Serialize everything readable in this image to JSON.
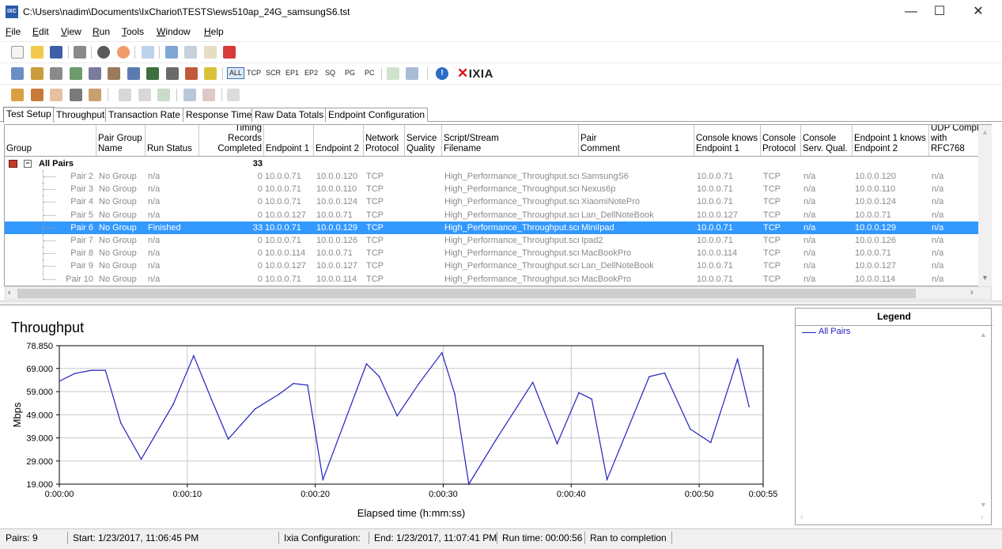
{
  "window": {
    "title": "C:\\Users\\nadim\\Documents\\IxChariot\\TESTS\\ews510ap_24G_samsungS6.tst",
    "app_icon_text": "IXC",
    "minimize": "—",
    "maximize": "☐",
    "close": "✕"
  },
  "menu": {
    "items": [
      {
        "label": "File",
        "key": "F",
        "rest": "ile"
      },
      {
        "label": "Edit",
        "key": "E",
        "rest": "dit"
      },
      {
        "label": "View",
        "key": "V",
        "rest": "iew"
      },
      {
        "label": "Run",
        "key": "R",
        "rest": "un"
      },
      {
        "label": "Tools",
        "key": "T",
        "rest": "ools"
      },
      {
        "label": "Window",
        "key": "W",
        "rest": "indow"
      },
      {
        "label": "Help",
        "key": "H",
        "rest": "elp"
      }
    ]
  },
  "toolbar2": {
    "filters": [
      "ALL",
      "TCP",
      "SCR",
      "EP1",
      "EP2",
      "SQ",
      "PG",
      "PC"
    ],
    "logo": "IXIA"
  },
  "tabs": [
    {
      "label": "Test Setup",
      "active": true
    },
    {
      "label": "Throughput",
      "active": false
    },
    {
      "label": "Transaction Rate",
      "active": false
    },
    {
      "label": "Response Time",
      "active": false
    },
    {
      "label": "Raw Data Totals",
      "active": false
    },
    {
      "label": "Endpoint Configuration",
      "active": false
    }
  ],
  "grid": {
    "columns": [
      "Group",
      "Pair Group\nName",
      "Run Status",
      "Timing Records\nCompleted",
      "Endpoint 1",
      "Endpoint 2",
      "Network\nProtocol",
      "Service\nQuality",
      "Script/Stream\nFilename",
      "Pair\nComment",
      "Console knows\nEndpoint 1",
      "Console\nProtocol",
      "Console\nServ. Qual.",
      "Endpoint 1 knows\nEndpoint 2",
      "UDP Compli\nwith RFC768"
    ],
    "all_pairs": {
      "label": "All Pairs",
      "records": "33"
    },
    "rows": [
      {
        "pair": "Pair 2",
        "group_name": "No Group",
        "status": "n/a",
        "records": "0",
        "ep1": "10.0.0.71",
        "ep2": "10.0.0.120",
        "proto": "TCP",
        "sq": "",
        "script": "High_Performance_Throughput.scr",
        "comment": "SamsungS6",
        "ck_ep1": "10.0.0.71",
        "c_proto": "TCP",
        "c_sq": "n/a",
        "ep1_knows": "10.0.0.120",
        "udp": "n/a",
        "selected": false
      },
      {
        "pair": "Pair 3",
        "group_name": "No Group",
        "status": "n/a",
        "records": "0",
        "ep1": "10.0.0.71",
        "ep2": "10.0.0.110",
        "proto": "TCP",
        "sq": "",
        "script": "High_Performance_Throughput.scr",
        "comment": "Nexus6p",
        "ck_ep1": "10.0.0.71",
        "c_proto": "TCP",
        "c_sq": "n/a",
        "ep1_knows": "10.0.0.110",
        "udp": "n/a",
        "selected": false
      },
      {
        "pair": "Pair 4",
        "group_name": "No Group",
        "status": "n/a",
        "records": "0",
        "ep1": "10.0.0.71",
        "ep2": "10.0.0.124",
        "proto": "TCP",
        "sq": "",
        "script": "High_Performance_Throughput.scr",
        "comment": "XiaomiNotePro",
        "ck_ep1": "10.0.0.71",
        "c_proto": "TCP",
        "c_sq": "n/a",
        "ep1_knows": "10.0.0.124",
        "udp": "n/a",
        "selected": false
      },
      {
        "pair": "Pair 5",
        "group_name": "No Group",
        "status": "n/a",
        "records": "0",
        "ep1": "10.0.0.127",
        "ep2": "10.0.0.71",
        "proto": "TCP",
        "sq": "",
        "script": "High_Performance_Throughput.scr",
        "comment": "Lan_DellNoteBook",
        "ck_ep1": "10.0.0.127",
        "c_proto": "TCP",
        "c_sq": "n/a",
        "ep1_knows": "10.0.0.71",
        "udp": "n/a",
        "selected": false
      },
      {
        "pair": "Pair 6",
        "group_name": "No Group",
        "status": "Finished",
        "records": "33",
        "ep1": "10.0.0.71",
        "ep2": "10.0.0.129",
        "proto": "TCP",
        "sq": "",
        "script": "High_Performance_Throughput.scr",
        "comment": "MiniIpad",
        "ck_ep1": "10.0.0.71",
        "c_proto": "TCP",
        "c_sq": "n/a",
        "ep1_knows": "10.0.0.129",
        "udp": "n/a",
        "selected": true
      },
      {
        "pair": "Pair 7",
        "group_name": "No Group",
        "status": "n/a",
        "records": "0",
        "ep1": "10.0.0.71",
        "ep2": "10.0.0.126",
        "proto": "TCP",
        "sq": "",
        "script": "High_Performance_Throughput.scr",
        "comment": "Ipad2",
        "ck_ep1": "10.0.0.71",
        "c_proto": "TCP",
        "c_sq": "n/a",
        "ep1_knows": "10.0.0.126",
        "udp": "n/a",
        "selected": false
      },
      {
        "pair": "Pair 8",
        "group_name": "No Group",
        "status": "n/a",
        "records": "0",
        "ep1": "10.0.0.114",
        "ep2": "10.0.0.71",
        "proto": "TCP",
        "sq": "",
        "script": "High_Performance_Throughput.scr",
        "comment": "MacBookPro",
        "ck_ep1": "10.0.0.114",
        "c_proto": "TCP",
        "c_sq": "n/a",
        "ep1_knows": "10.0.0.71",
        "udp": "n/a",
        "selected": false
      },
      {
        "pair": "Pair 9",
        "group_name": "No Group",
        "status": "n/a",
        "records": "0",
        "ep1": "10.0.0.127",
        "ep2": "10.0.0.127",
        "proto": "TCP",
        "sq": "",
        "script": "High_Performance_Throughput.scr",
        "comment": "Lan_DellNoteBook",
        "ck_ep1": "10.0.0.71",
        "c_proto": "TCP",
        "c_sq": "n/a",
        "ep1_knows": "10.0.0.127",
        "udp": "n/a",
        "selected": false
      },
      {
        "pair": "Pair 10",
        "group_name": "No Group",
        "status": "n/a",
        "records": "0",
        "ep1": "10.0.0.71",
        "ep2": "10.0.0.114",
        "proto": "TCP",
        "sq": "",
        "script": "High_Performance_Throughput.scr",
        "comment": "MacBookPro",
        "ck_ep1": "10.0.0.71",
        "c_proto": "TCP",
        "c_sq": "n/a",
        "ep1_knows": "10.0.0.114",
        "udp": "n/a",
        "selected": false
      }
    ]
  },
  "legend": {
    "title": "Legend",
    "entries": [
      {
        "name": "All Pairs",
        "color": "#2020c0"
      }
    ]
  },
  "chart_data": {
    "type": "line",
    "title": "Throughput",
    "xlabel": "Elapsed time (h:mm:ss)",
    "ylabel": "Mbps",
    "yticks": [
      "78.850",
      "69.000",
      "59.000",
      "49.000",
      "39.000",
      "29.000",
      "19.000"
    ],
    "ytick_values": [
      78.85,
      69,
      59,
      49,
      39,
      29,
      19
    ],
    "xticks": [
      "0:00:00",
      "0:00:10",
      "0:00:20",
      "0:00:30",
      "0:00:40",
      "0:00:50",
      "0:00:55"
    ],
    "xtick_values": [
      0,
      10,
      20,
      30,
      40,
      50,
      55
    ],
    "xlim": [
      0,
      55
    ],
    "ylim": [
      19,
      78.85
    ],
    "grid": true,
    "series": [
      {
        "name": "All Pairs",
        "color": "#2020c0",
        "points": [
          [
            0,
            63.5
          ],
          [
            1.2,
            66.8
          ],
          [
            2.5,
            68.2
          ],
          [
            3.6,
            68.2
          ],
          [
            4.8,
            45.5
          ],
          [
            6.4,
            29.8
          ],
          [
            8.9,
            53.5
          ],
          [
            10.5,
            74.5
          ],
          [
            11.9,
            55.5
          ],
          [
            13.2,
            38.5
          ],
          [
            15.3,
            51.5
          ],
          [
            17.2,
            58.0
          ],
          [
            18.3,
            62.5
          ],
          [
            19.4,
            61.8
          ],
          [
            20.6,
            21.0
          ],
          [
            24.0,
            71.0
          ],
          [
            25.0,
            65.5
          ],
          [
            26.4,
            48.5
          ],
          [
            28.1,
            62.5
          ],
          [
            29.9,
            75.8
          ],
          [
            30.9,
            58.0
          ],
          [
            32.0,
            19.0
          ],
          [
            34.1,
            38.0
          ],
          [
            37.0,
            63.0
          ],
          [
            38.9,
            36.5
          ],
          [
            40.6,
            58.5
          ],
          [
            41.6,
            55.8
          ],
          [
            42.8,
            21.0
          ],
          [
            46.1,
            65.5
          ],
          [
            47.3,
            67.0
          ],
          [
            49.3,
            42.8
          ],
          [
            50.9,
            37.0
          ],
          [
            53.0,
            73.0
          ],
          [
            53.9,
            52.5
          ]
        ]
      }
    ]
  },
  "status": {
    "pairs": "Pairs: 9",
    "start": "Start: 1/23/2017, 11:06:45 PM",
    "ixia_config": "Ixia Configuration:",
    "end": "End: 1/23/2017, 11:07:41 PM",
    "run_time": "Run time: 00:00:56",
    "completion": "Ran to completion"
  }
}
